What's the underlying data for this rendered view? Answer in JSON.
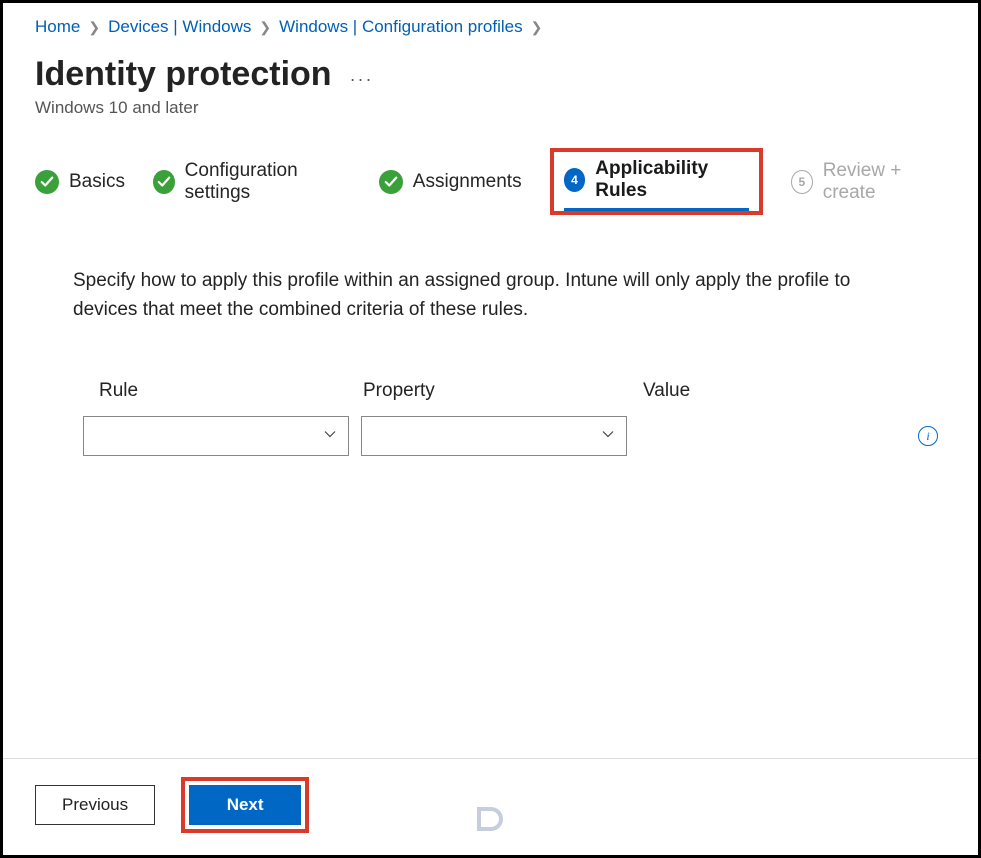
{
  "breadcrumb": {
    "items": [
      {
        "label": "Home"
      },
      {
        "label": "Devices | Windows"
      },
      {
        "label": "Windows | Configuration profiles"
      }
    ]
  },
  "page": {
    "title": "Identity protection",
    "subtitle": "Windows 10 and later"
  },
  "steps": [
    {
      "label": "Basics",
      "state": "done"
    },
    {
      "label": "Configuration settings",
      "state": "done"
    },
    {
      "label": "Assignments",
      "state": "done"
    },
    {
      "label": "Applicability Rules",
      "state": "current",
      "number": "4"
    },
    {
      "label": "Review + create",
      "state": "future",
      "number": "5"
    }
  ],
  "description": "Specify how to apply this profile within an assigned group. Intune will only apply the profile to devices that meet the combined criteria of these rules.",
  "rules": {
    "headers": {
      "rule": "Rule",
      "property": "Property",
      "value": "Value"
    },
    "row": {
      "rule_value": "",
      "property_value": "",
      "value_value": ""
    }
  },
  "footer": {
    "previous": "Previous",
    "next": "Next"
  }
}
